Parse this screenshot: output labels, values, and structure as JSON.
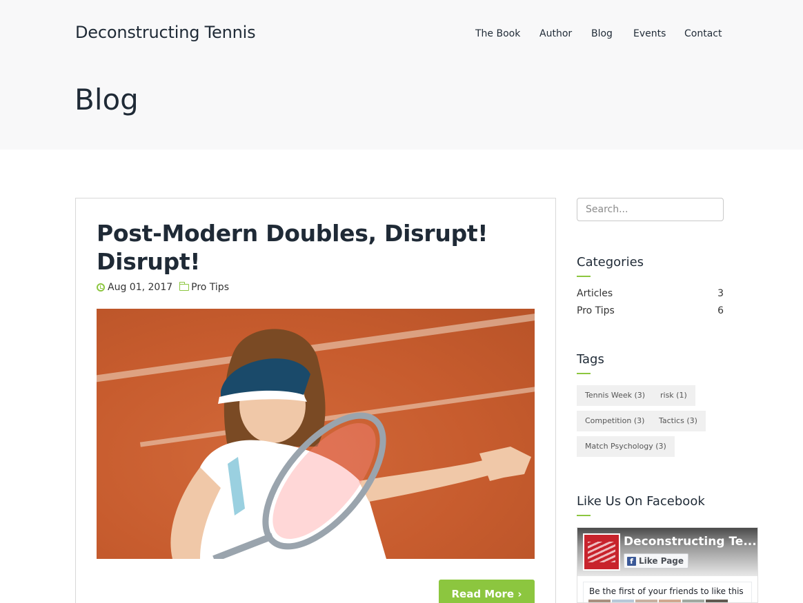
{
  "header": {
    "site_title": "Deconstructing Tennis",
    "nav": [
      "The Book",
      "Author",
      "Blog",
      "Events",
      "Contact"
    ],
    "page_title": "Blog"
  },
  "post": {
    "title": "Post-Modern Doubles, Disrupt! Disrupt!",
    "date": "Aug 01, 2017",
    "category": "Pro Tips",
    "image_icon": "tennis-player-photo",
    "read_more": "Read More ›"
  },
  "sidebar": {
    "search_placeholder": "Search...",
    "categories_title": "Categories",
    "categories": [
      {
        "name": "Articles",
        "count": "3"
      },
      {
        "name": "Pro Tips",
        "count": "6"
      }
    ],
    "tags_title": "Tags",
    "tags": [
      "Tennis Week (3)",
      "risk (1)",
      "Competition (3)",
      "Tactics (3)",
      "Match Psychology (3)"
    ],
    "facebook_title": "Like Us On Facebook",
    "facebook": {
      "page_name": "Deconstructing Te...",
      "like_label": "Like Page",
      "friends_text": "Be the first of your friends to like this"
    }
  },
  "colors": {
    "accent": "#8cc63f",
    "text": "#1f2a36",
    "header_bg": "#f8f8f9"
  }
}
